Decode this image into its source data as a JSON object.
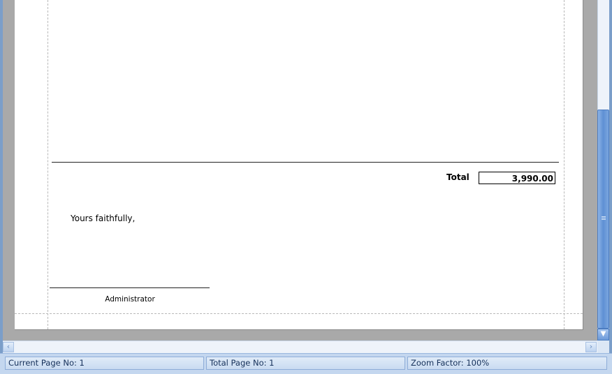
{
  "document": {
    "total_label": "Total",
    "total_value": "3,990.00",
    "closing": "Yours faithfully,",
    "signer": "Administrator"
  },
  "statusbar": {
    "current_page": "Current Page No: 1",
    "total_pages": "Total Page No: 1",
    "zoom": "Zoom Factor: 100%"
  },
  "scrollbars": {
    "up_icon": "scroll-left-arrow",
    "down_icon": "scroll-down-arrow"
  },
  "colors": {
    "frame": "#7b9ec9",
    "background": "#a9a9a9",
    "thumb": "#5f90d4"
  }
}
